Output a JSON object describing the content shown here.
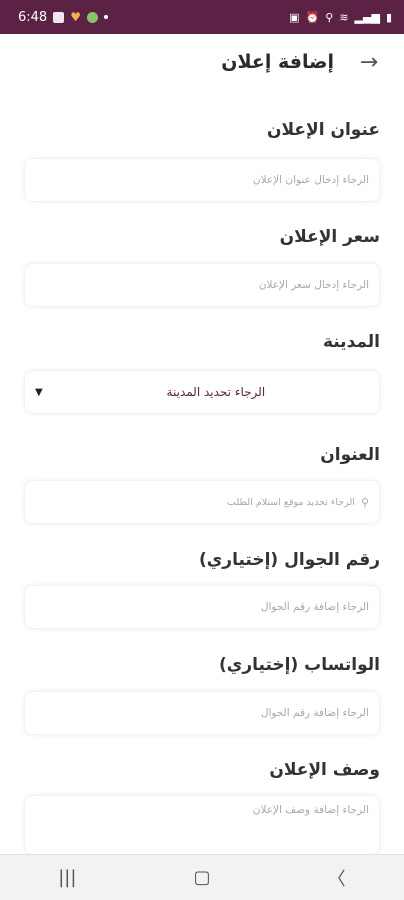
{
  "status_bar": {
    "time": "6:48"
  },
  "header": {
    "title": "إضافة إعلان",
    "back_icon": "arrow-right-icon"
  },
  "form": {
    "ad_title": {
      "label": "عنوان الإعلان",
      "placeholder": "الرجاء إدخال عنوان الإعلان"
    },
    "ad_price": {
      "label": "سعر الإعلان",
      "placeholder": "الرجاء إدخال سعر الإعلان"
    },
    "city": {
      "label": "المدينة",
      "selected": "الرجاء تحديد المدينة"
    },
    "address": {
      "label": "العنوان",
      "placeholder": "الرجاء تحديد موقع استلام الطلب"
    },
    "phone": {
      "label": "رقم الجوال (إختياري)",
      "placeholder": "الرجاء إضافة رقم الجوال"
    },
    "whatsapp": {
      "label": "الواتساب (إختياري)",
      "placeholder": "الرجاء إضافة رقم الجوال"
    },
    "description": {
      "label": "وصف الإعلان",
      "placeholder": "الرجاء إضافة وصف الإعلان"
    }
  },
  "colors": {
    "status_bar": "#5b2245",
    "accent_text": "#5b2245"
  }
}
